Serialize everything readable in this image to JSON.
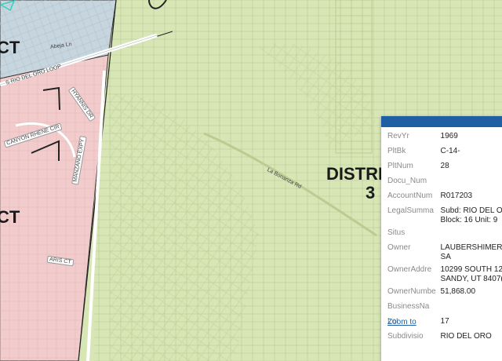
{
  "map": {
    "districts": [
      {
        "id": "left-top",
        "label": "CT"
      },
      {
        "id": "left-bottom",
        "label": "CT"
      },
      {
        "id": "center",
        "label_line1": "DISTRI",
        "label_line2": "3"
      }
    ],
    "streets": {
      "abeja": "Abeja Ln",
      "loop": "S RIO DEL ORO LOOP",
      "hyannis": "HYANNIS DR",
      "canyon": "CANYON RHENE CIR",
      "manzano": "MANZANO EXPY",
      "aris": "ARIS CT",
      "la_bonanza": "La Bonanza Rd"
    },
    "colors": {
      "district_green": "#d8e6b6",
      "district_red": "#f2cccc",
      "district_blue": "#c7d5de",
      "popup_header": "#1f5fa3"
    }
  },
  "popup": {
    "rows": [
      {
        "key": "RevYr",
        "value": "1969"
      },
      {
        "key": "PltBk",
        "value": "C-14-"
      },
      {
        "key": "PltNum",
        "value": "28"
      },
      {
        "key": "Docu_Num",
        "value": ""
      },
      {
        "key": "AccountNum",
        "value": "R017203"
      },
      {
        "key": "LegalSumma",
        "value": "Subd: RIO DEL O\nBlock: 16 Unit: 9"
      },
      {
        "key": "Situs",
        "value": ""
      },
      {
        "key": "Owner",
        "value": "LAUBERSHIMER I\nSA"
      },
      {
        "key": "OwnerAddre",
        "value": "10299 SOUTH 12\nSANDY, UT 8407("
      },
      {
        "key": "OwnerNumbe",
        "value": "51,868.00"
      },
      {
        "key": "BusinessNa",
        "value": ""
      },
      {
        "key": "Lot",
        "value": "17"
      },
      {
        "key": "Subdivisio",
        "value": "RIO DEL ORO"
      }
    ],
    "zoom_label": "Zoom to"
  }
}
